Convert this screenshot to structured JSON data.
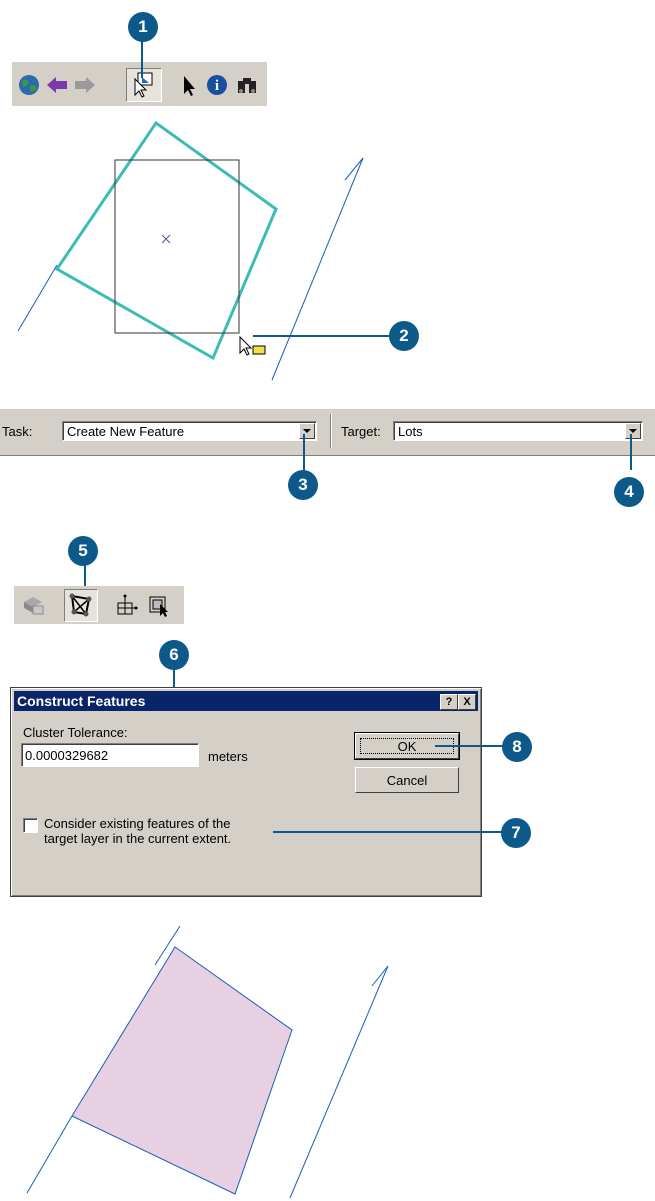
{
  "callouts": {
    "c1": "1",
    "c2": "2",
    "c3": "3",
    "c4": "4",
    "c5": "5",
    "c6": "6",
    "c7": "7",
    "c8": "8"
  },
  "tools_toolbar": {
    "icons": [
      "globe-icon",
      "back-arrow-icon",
      "forward-arrow-icon",
      "select-features-icon",
      "select-elements-icon",
      "identify-icon",
      "find-icon"
    ]
  },
  "editor_toolbar": {
    "task_label": "Task:",
    "task_value": "Create New Feature",
    "target_label": "Target:",
    "target_value": "Lots"
  },
  "topology_toolbar": {
    "icons": [
      "topology-icon",
      "construct-features-icon",
      "planarize-icon",
      "validate-topology-icon"
    ]
  },
  "dialog": {
    "title": "Construct Features",
    "help_button": "?",
    "close_button": "X",
    "cluster_label": "Cluster Tolerance:",
    "cluster_value": "0.0000329682",
    "units": "meters",
    "ok_label": "OK",
    "cancel_label": "Cancel",
    "checkbox_label_line1": "Consider existing features of the",
    "checkbox_label_line2": "target layer in the current extent.",
    "checkbox_checked": false
  },
  "colors": {
    "callout": "#0d5a8a",
    "selection_outline": "#3cbcb4",
    "parcel_line": "#1a5fb4",
    "polygon_fill": "#e8d0e3",
    "titlebar": "#0a246a"
  }
}
